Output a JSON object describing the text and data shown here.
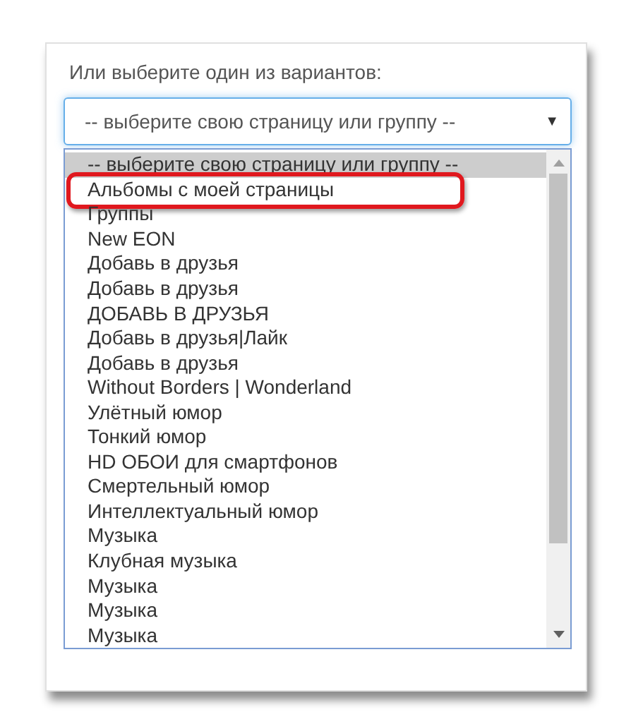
{
  "label": "Или выберите один из вариантов:",
  "select": {
    "value": "-- выберите свою страницу или группу --",
    "arrow": "▼"
  },
  "options": [
    {
      "label": "-- выберите свою страницу или группу --",
      "selected": true,
      "highlighted": false
    },
    {
      "label": "Альбомы с моей страницы",
      "selected": false,
      "highlighted": true
    },
    {
      "label": "Группы",
      "selected": false,
      "highlighted": false
    },
    {
      "label": "New EON",
      "selected": false,
      "highlighted": false
    },
    {
      "label": "Добавь в друзья",
      "selected": false,
      "highlighted": false
    },
    {
      "label": "Добавь в друзья",
      "selected": false,
      "highlighted": false
    },
    {
      "label": "ДОБАВЬ В ДРУЗЬЯ",
      "selected": false,
      "highlighted": false
    },
    {
      "label": "Добавь в друзья|Лайк",
      "selected": false,
      "highlighted": false
    },
    {
      "label": "Добавь в друзья",
      "selected": false,
      "highlighted": false
    },
    {
      "label": "Without Borders | Wonderland",
      "selected": false,
      "highlighted": false
    },
    {
      "label": "Улётный юмор",
      "selected": false,
      "highlighted": false
    },
    {
      "label": "Тонкий юмор",
      "selected": false,
      "highlighted": false
    },
    {
      "label": "HD ОБОИ для смартфонов",
      "selected": false,
      "highlighted": false
    },
    {
      "label": "Смертельный юмор",
      "selected": false,
      "highlighted": false
    },
    {
      "label": "Интеллектуальный юмор",
      "selected": false,
      "highlighted": false
    },
    {
      "label": "Музыка",
      "selected": false,
      "highlighted": false
    },
    {
      "label": "Клубная музыка",
      "selected": false,
      "highlighted": false
    },
    {
      "label": "Музыка",
      "selected": false,
      "highlighted": false
    },
    {
      "label": "Музыка",
      "selected": false,
      "highlighted": false
    },
    {
      "label": "Музыка",
      "selected": false,
      "highlighted": false
    }
  ]
}
